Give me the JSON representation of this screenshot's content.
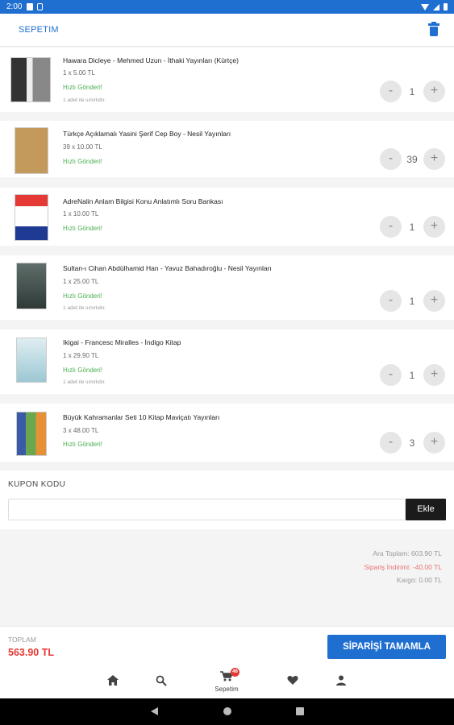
{
  "status_bar": {
    "time": "2:00"
  },
  "header": {
    "title": "SEPETIM"
  },
  "items": [
    {
      "title": "Hawara Dicleye - Mehmed Uzun - İthaki Yayınları (Kürtçe)",
      "price": "1 x 5.00 TL",
      "shipping": "Hızlı Gönderi!",
      "note": "1 adet ile sınırlıdır.",
      "qty": "1"
    },
    {
      "title": "Türkçe Açıklamalı Yasini Şerif Cep Boy - Nesil Yayınları",
      "price": "39 x 10.00 TL",
      "shipping": "Hızlı Gönderi!",
      "note": "",
      "qty": "39"
    },
    {
      "title": "AdreNalin Anlam Bilgisi Konu Anlatımlı Soru Bankası",
      "price": "1 x 10.00 TL",
      "shipping": "Hızlı Gönderi!",
      "note": "",
      "qty": "1"
    },
    {
      "title": "Sultan-ı Cihan Abdülhamid Han - Yavuz Bahadıroğlu - Nesil Yayınları",
      "price": "1 x 25.00 TL",
      "shipping": "Hızlı Gönderi!",
      "note": "1 adet ile sınırlıdır.",
      "qty": "1"
    },
    {
      "title": "Ikigai - Francesc Miralles - İndigo Kitap",
      "price": "1 x 29.90 TL",
      "shipping": "Hızlı Gönderi!",
      "note": "1 adet ile sınırlıdır.",
      "qty": "1"
    },
    {
      "title": "Büyük Kahramanlar Seti 10 Kitap Maviçatı Yayınları",
      "price": "3 x 48.00 TL",
      "shipping": "Hızlı Gönderi!",
      "note": "",
      "qty": "3"
    }
  ],
  "qty_controls": {
    "minus": "-",
    "plus": "+"
  },
  "coupon": {
    "label": "KUPON KODU",
    "placeholder": "",
    "button": "Ekle"
  },
  "summary": {
    "subtotal": "Ara Toplam: 603.90 TL",
    "discount": "Sipariş İndirimi: -40.00 TL",
    "shipping": "Kargo: 0.00 TL"
  },
  "footer": {
    "total_label": "TOPLAM",
    "total_value": "563.90 TL",
    "checkout": "SİPARİŞİ TAMAMLA"
  },
  "bottom_nav": {
    "cart_label": "Sepetim",
    "cart_badge": "46"
  },
  "colors": {
    "accent": "#1f6fd1",
    "price_red": "#e53935",
    "ship_green": "#4caf50"
  }
}
